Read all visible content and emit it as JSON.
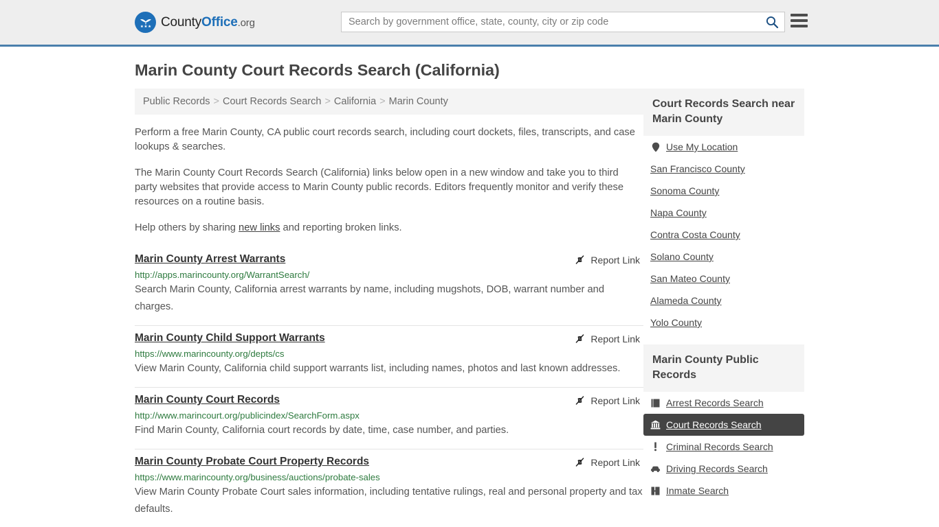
{
  "header": {
    "logo": {
      "part1": "County",
      "part2": "Office",
      "part3": ".org",
      "icon": "eagle-stars-emblem"
    },
    "search": {
      "placeholder": "Search by government office, state, county, city or zip code",
      "value": "",
      "icon": "search-icon"
    },
    "menu_icon": "hamburger-menu-icon",
    "accent_color": "#4a7fac",
    "background": "#eeeeee"
  },
  "page_title": "Marin County Court Records Search (California)",
  "breadcrumb": {
    "separator": ">",
    "items": [
      "Public Records",
      "Court Records Search",
      "California",
      "Marin County"
    ]
  },
  "intro": {
    "p1": "Perform a free Marin County, CA public court records search, including court dockets, files, transcripts, and case lookups & searches.",
    "p2": "The Marin County Court Records Search (California) links below open in a new window and take you to third party websites that provide access to Marin County public records. Editors frequently monitor and verify these resources on a routine basis.",
    "p3_before": "Help others by sharing ",
    "p3_link": "new links",
    "p3_after": " and reporting broken links."
  },
  "report_link": {
    "label": "Report Link",
    "icon": "broken-link-icon"
  },
  "results": [
    {
      "title": "Marin County Arrest Warrants",
      "url": "http://apps.marincounty.org/WarrantSearch/",
      "description": "Search Marin County, California arrest warrants by name, including mugshots, DOB, warrant number and charges."
    },
    {
      "title": "Marin County Child Support Warrants",
      "url": "https://www.marincounty.org/depts/cs",
      "description": "View Marin County, California child support warrants list, including names, photos and last known addresses."
    },
    {
      "title": "Marin County Court Records",
      "url": "http://www.marincourt.org/publicindex/SearchForm.aspx",
      "description": "Find Marin County, California court records by date, time, case number, and parties."
    },
    {
      "title": "Marin County Probate Court Property Records",
      "url": "https://www.marincounty.org/business/auctions/probate-sales",
      "description": "View Marin County Probate Court sales information, including tentative rulings, real and personal property and tax defaults."
    }
  ],
  "sidebar": {
    "nearby": {
      "heading": "Court Records Search near Marin County",
      "items": [
        {
          "label": "Use My Location",
          "icon": "map-pin-icon"
        },
        {
          "label": "San Francisco County",
          "icon": ""
        },
        {
          "label": "Sonoma County",
          "icon": ""
        },
        {
          "label": "Napa County",
          "icon": ""
        },
        {
          "label": "Contra Costa County",
          "icon": ""
        },
        {
          "label": "Solano County",
          "icon": ""
        },
        {
          "label": "San Mateo County",
          "icon": ""
        },
        {
          "label": "Alameda County",
          "icon": ""
        },
        {
          "label": "Yolo County",
          "icon": ""
        }
      ]
    },
    "public_records": {
      "heading": "Marin County Public Records",
      "active_index": 1,
      "active_color": "#444444",
      "items": [
        {
          "label": "Arrest Records Search",
          "icon": "book-icon"
        },
        {
          "label": "Court Records Search",
          "icon": "courthouse-icon"
        },
        {
          "label": "Criminal Records Search",
          "icon": "exclamation-icon"
        },
        {
          "label": "Driving Records Search",
          "icon": "car-icon"
        },
        {
          "label": "Inmate Search",
          "icon": "jail-icon"
        }
      ]
    }
  }
}
